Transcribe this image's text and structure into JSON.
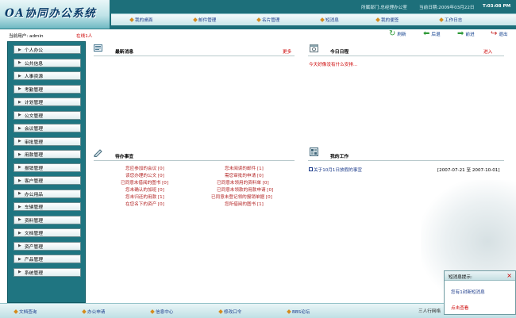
{
  "app": {
    "title": "OA协同办公系统",
    "dept_info": "所属部门:总经理办公室",
    "date_info": "当前日期:2009年03月22日",
    "time_info": "T:03:08 PM"
  },
  "topnav": [
    {
      "label": "我的桌面"
    },
    {
      "label": "邮件管理"
    },
    {
      "label": "名片管理"
    },
    {
      "label": "短消息"
    },
    {
      "label": "我的便签"
    },
    {
      "label": "工作日志"
    }
  ],
  "user": {
    "current_user": "当前用户: admin",
    "online": "在线1人"
  },
  "toolbar": {
    "refresh": "刷新",
    "back": "后退",
    "forward": "前进",
    "logout": "退出"
  },
  "sidebar": {
    "items": [
      {
        "label": "个人办公"
      },
      {
        "label": "公共信息"
      },
      {
        "label": "人事资源"
      },
      {
        "label": "考勤管理"
      },
      {
        "label": "计划管理"
      },
      {
        "label": "公文管理"
      },
      {
        "label": "会议管理"
      },
      {
        "label": "审批管理"
      },
      {
        "label": "用款管理"
      },
      {
        "label": "报销管理"
      },
      {
        "label": "客户管理"
      },
      {
        "label": "办公用品"
      },
      {
        "label": "车辆管理"
      },
      {
        "label": "资料管理"
      },
      {
        "label": "文档管理"
      },
      {
        "label": "资产管理"
      },
      {
        "label": "产品管理"
      },
      {
        "label": "系统管理"
      }
    ]
  },
  "panels": {
    "news": {
      "title": "最新消息",
      "more": "更多"
    },
    "schedule": {
      "title": "今日日程",
      "enter": "进入",
      "empty_msg": "今天好像没有什么安排..."
    },
    "todo": {
      "title": "待办事宜",
      "left": [
        "您应参加的会议 [0]",
        "该您办理的公文 [0]",
        "已同意未借阅的图书 [0]",
        "您未确认的加班 [0]",
        "您未归还的用款 [1]",
        "在您名下的资产 [0]"
      ],
      "right": [
        "您未阅读的邮件 [1]",
        "需您审批的申请 [0]",
        "已同意未领用的资料单 [0]",
        "已同意未领款的用款申请 [0]",
        "已同意未登记领的报销单据 [0]",
        "您所借阅的图书 [1]"
      ]
    },
    "work": {
      "title": "我的工作",
      "item": "关于10月1日放假的事宜",
      "range": "[2007-07-21 至 2007-10-01]"
    }
  },
  "bottomnav": [
    {
      "label": "文档查询"
    },
    {
      "label": "办公申请"
    },
    {
      "label": "信息中心"
    },
    {
      "label": "修改口令"
    },
    {
      "label": "BBS论坛"
    }
  ],
  "footer": {
    "company": "三人行网络"
  },
  "popup": {
    "title": "短消息提示:",
    "message": "您有1封新短消息",
    "view": "点击查看"
  },
  "colors": {
    "header_bg": "#1d6f7a",
    "sidebar_bg": "#1f7581",
    "link_red": "#b22222",
    "link_blue": "#1a3a8a",
    "bullet_orange": "#d58c1e"
  }
}
